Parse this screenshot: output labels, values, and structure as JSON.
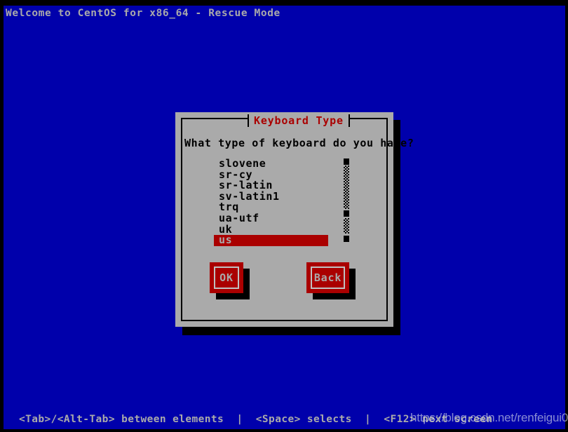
{
  "screen": {
    "background_color": "#0000ab",
    "border_color": "#000000",
    "text_color": "#aaaaaa"
  },
  "header": {
    "title": "Welcome to CentOS for x86_64 - Rescue Mode"
  },
  "footer": {
    "help_text": "<Tab>/<Alt-Tab> between elements  |  <Space> selects  |  <F12> next screen",
    "watermark": "https://blog.csdn.net/renfeigui0"
  },
  "dialog": {
    "title": "Keyboard Type",
    "title_color": "#aa0000",
    "background_color": "#aaaaaa",
    "question": "What type of keyboard do you have?",
    "list": {
      "items": [
        {
          "label": "slovene",
          "selected": false
        },
        {
          "label": "sr-cy",
          "selected": false
        },
        {
          "label": "sr-latin",
          "selected": false
        },
        {
          "label": "sv-latin1",
          "selected": false
        },
        {
          "label": "trq",
          "selected": false
        },
        {
          "label": "ua-utf",
          "selected": false
        },
        {
          "label": "uk",
          "selected": false
        },
        {
          "label": "us",
          "selected": true
        }
      ],
      "selected_value": "us",
      "highlight_color": "#aa0000"
    },
    "scrollbar": {
      "name": "vertical-scrollbar",
      "position": "near-bottom"
    },
    "buttons": {
      "ok_label": "OK",
      "back_label": "Back",
      "button_color": "#aa0000",
      "button_text_color": "#aaaaaa"
    }
  }
}
